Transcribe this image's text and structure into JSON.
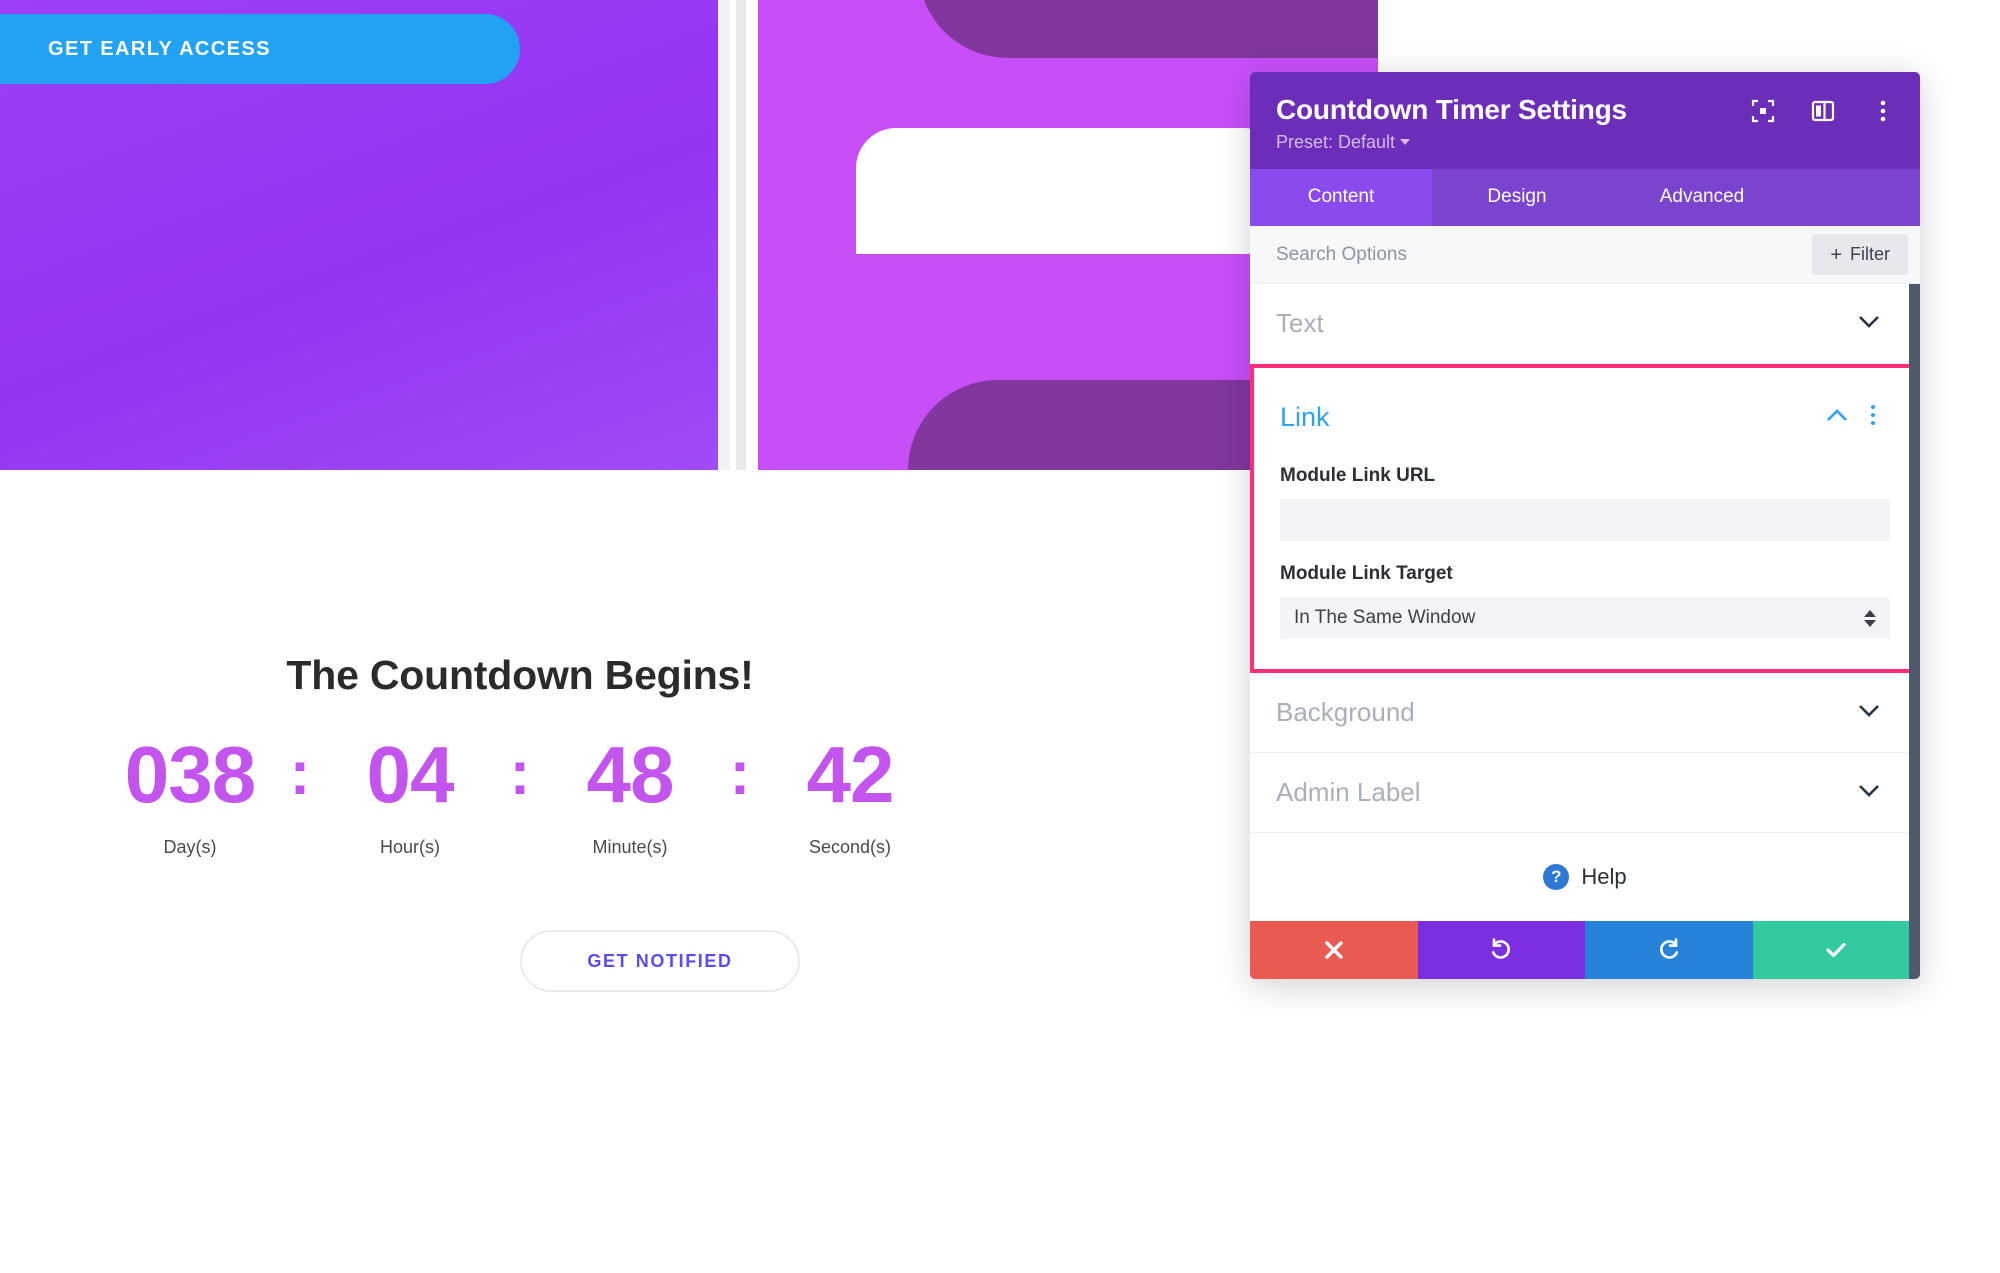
{
  "page": {
    "hero_cta_label": "GET EARLY ACCESS",
    "countdown_title": "The Countdown Begins!",
    "countdown_button_label": "GET NOTIFIED",
    "separator": ":",
    "units": [
      {
        "value": "038",
        "label": "Day(s)"
      },
      {
        "value": "04",
        "label": "Hour(s)"
      },
      {
        "value": "48",
        "label": "Minute(s)"
      },
      {
        "value": "42",
        "label": "Second(s)"
      }
    ],
    "colors": {
      "hero_left": "#9D3FF6",
      "hero_right": "#C84FF8",
      "hero_blob": "#7B3596",
      "cta_blue": "#22A2F2",
      "countdown_number": "#C454EE",
      "notify_text": "#5B4BF5"
    }
  },
  "modal": {
    "title": "Countdown Timer Settings",
    "preset_label": "Preset: Default",
    "header_icons": [
      {
        "name": "focus-frame-icon"
      },
      {
        "name": "split-layout-icon"
      },
      {
        "name": "kebab-menu-icon"
      }
    ],
    "tabs": [
      {
        "label": "Content",
        "active": true
      },
      {
        "label": "Design",
        "active": false
      },
      {
        "label": "Advanced",
        "active": false
      }
    ],
    "search": {
      "placeholder": "Search Options",
      "value": "",
      "filter_label": "Filter",
      "filter_plus": "+"
    },
    "sections": [
      {
        "name": "Text",
        "state": "collapsed"
      },
      {
        "name": "Background",
        "state": "collapsed"
      },
      {
        "name": "Admin Label",
        "state": "collapsed"
      }
    ],
    "link_section": {
      "title": "Link",
      "state": "expanded",
      "highlight_color": "#FF2D78",
      "title_color": "#2EA3F2",
      "fields": [
        {
          "type": "text",
          "label": "Module Link URL",
          "value": "",
          "placeholder": ""
        },
        {
          "type": "select",
          "label": "Module Link Target",
          "value": "In The Same Window"
        }
      ]
    },
    "help": {
      "label": "Help",
      "badge": "?"
    },
    "actions": [
      {
        "name": "cancel",
        "icon": "close-x-icon",
        "color": "#E85A52"
      },
      {
        "name": "undo",
        "icon": "undo-icon",
        "color": "#7B2FE0"
      },
      {
        "name": "redo",
        "icon": "redo-icon",
        "color": "#2683D8"
      },
      {
        "name": "save",
        "icon": "checkmark-icon",
        "color": "#32C9A0"
      }
    ]
  }
}
